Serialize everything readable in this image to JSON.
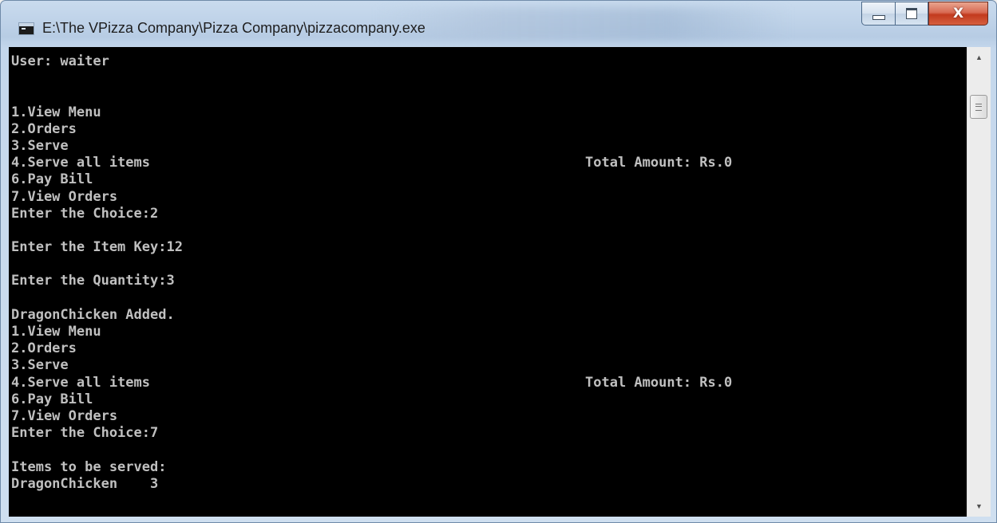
{
  "window": {
    "title": "E:\\The VPizza Company\\Pizza Company\\pizzacompany.exe",
    "icon": "console-app-icon",
    "caption_buttons": {
      "minimize": "minimize-icon",
      "maximize": "maximize-icon",
      "close": "X"
    }
  },
  "console": {
    "text_color": "#c0c0c0",
    "background": "#000000",
    "lines": [
      "User: waiter",
      "",
      "",
      "1.View Menu",
      "2.Orders",
      "3.Serve",
      "4.Serve all items",
      "6.Pay Bill",
      "7.View Orders",
      "Enter the Choice:2",
      "",
      "Enter the Item Key:12",
      "",
      "Enter the Quantity:3",
      "",
      "DragonChicken Added.",
      "1.View Menu",
      "2.Orders",
      "3.Serve",
      "4.Serve all items",
      "6.Pay Bill",
      "7.View Orders",
      "Enter the Choice:7",
      "",
      "Items to be served:",
      "DragonChicken    3"
    ],
    "totals": [
      {
        "line_index": 6,
        "text": "Total Amount: Rs.0"
      },
      {
        "line_index": 19,
        "text": "Total Amount: Rs.0"
      }
    ]
  },
  "scrollbar": {
    "up_icon": "▲",
    "down_icon": "▼"
  }
}
